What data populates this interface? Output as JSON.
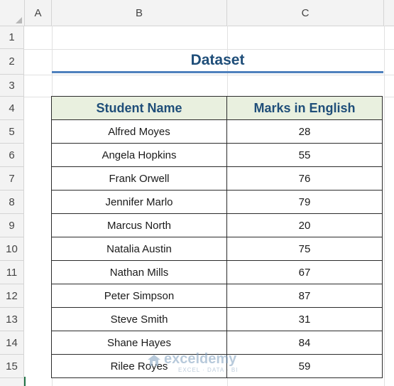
{
  "columns": {
    "a": "A",
    "b": "B",
    "c": "C"
  },
  "rows": [
    "1",
    "2",
    "3",
    "4",
    "5",
    "6",
    "7",
    "8",
    "9",
    "10",
    "11",
    "12",
    "13",
    "14",
    "15"
  ],
  "title": "Dataset",
  "table": {
    "headers": [
      "Student Name",
      "Marks in English"
    ],
    "rows": [
      [
        "Alfred Moyes",
        "28"
      ],
      [
        "Angela Hopkins",
        "55"
      ],
      [
        "Frank Orwell",
        "76"
      ],
      [
        "Jennifer Marlo",
        "79"
      ],
      [
        "Marcus North",
        "20"
      ],
      [
        "Natalia Austin",
        "75"
      ],
      [
        "Nathan Mills",
        "67"
      ],
      [
        "Peter Simpson",
        "87"
      ],
      [
        "Steve Smith",
        "31"
      ],
      [
        "Shane Hayes",
        "84"
      ],
      [
        "Rilee Royes",
        "59"
      ]
    ]
  },
  "watermark": {
    "name": "exceldemy",
    "tagline": "EXCEL · DATA · BI"
  },
  "colors": {
    "header_fill": "#e9f0df",
    "header_text": "#1f4e79",
    "title_text": "#1f4e79",
    "title_underline": "#4f81bd"
  }
}
